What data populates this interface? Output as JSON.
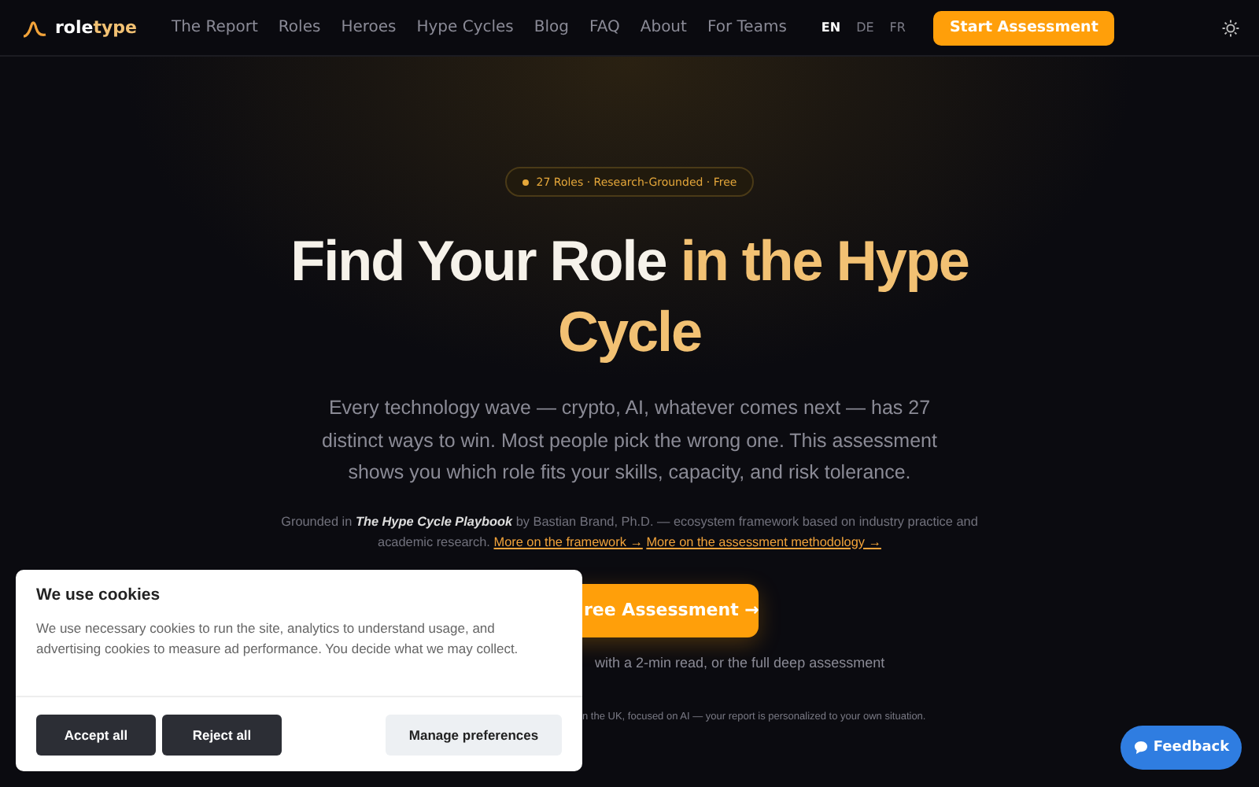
{
  "nav": {
    "logo": {
      "part1": "role",
      "part2": "type"
    },
    "links": [
      {
        "label": "The Report"
      },
      {
        "label": "Roles"
      },
      {
        "label": "Heroes"
      },
      {
        "label": "Hype Cycles"
      },
      {
        "label": "Blog"
      },
      {
        "label": "FAQ"
      },
      {
        "label": "About"
      },
      {
        "label": "For Teams"
      }
    ],
    "languages": [
      {
        "label": "EN",
        "selected": true
      },
      {
        "label": "DE",
        "selected": false
      },
      {
        "label": "FR",
        "selected": false
      }
    ],
    "cta": "Start Assessment"
  },
  "hero": {
    "badge": "27 Roles · Research-Grounded · Free",
    "title_white": "Find Your Role",
    "title_gold": "in the Hype Cycle",
    "lead": "Every technology wave — crypto, AI, whatever comes next — has 27 distinct ways to win. Most people pick the wrong one. This assessment shows you which role fits your skills, capacity, and risk tolerance.",
    "source": "Grounded in *The Hype Cycle Playbook* by Bastian Brand, Ph.D. — ecosystem framework based on industry practice and academic research.",
    "links": [
      {
        "label": "More on the framework →"
      },
      {
        "label": "More on the assessment methodology →"
      }
    ],
    "button": "ree Assessment →",
    "subline": "with a 2-min read, or the full deep assessment",
    "note": "n the UK, focused on AI — your report is personalized to your own situation."
  },
  "cookie_banner": {
    "title": "We use cookies",
    "text": "We use necessary cookies to run the site, analytics to understand usage, and advertising cookies to measure ad performance. You decide what we may collect.",
    "buttons": [
      {
        "label": "Accept all",
        "kind": "dark"
      },
      {
        "label": "Reject all",
        "kind": "dark"
      },
      {
        "label": "Manage preferences",
        "kind": "light"
      }
    ]
  },
  "feedback": "Feedback"
}
